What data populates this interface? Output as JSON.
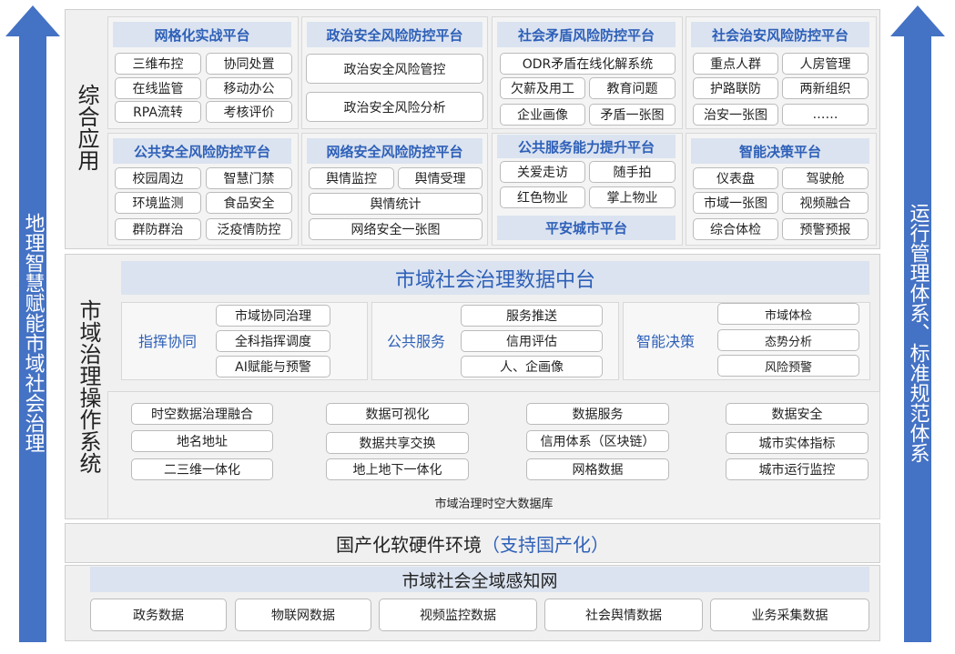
{
  "left_arrow": {
    "label": "地理智慧赋能市域社会治理"
  },
  "right_arrow": {
    "label": "运行管理体系、标准规范体系"
  },
  "app_layer": {
    "label": "综合应用",
    "platforms": [
      {
        "title": "网格化实战平台",
        "items": [
          "三维布控",
          "协同处置",
          "在线监管",
          "移动办公",
          "RPA流转",
          "考核评价"
        ]
      },
      {
        "title": "政治安全风险防控平台",
        "items": [
          "政治安全风险管控",
          "政治安全风险分析"
        ]
      },
      {
        "title": "社会矛盾风险防控平台",
        "items": [
          "ODR矛盾在线化解系统",
          "欠薪及用工",
          "教育问题",
          "企业画像",
          "矛盾一张图"
        ]
      },
      {
        "title": "社会治安风险防控平台",
        "items": [
          "重点人群",
          "人房管理",
          "护路联防",
          "两新组织",
          "治安一张图",
          "……"
        ]
      },
      {
        "title": "公共安全风险防控平台",
        "items": [
          "校园周边",
          "智慧门禁",
          "环境监测",
          "食品安全",
          "群防群治",
          "泛疫情防控"
        ]
      },
      {
        "title": "网络安全风险防控平台",
        "items": [
          "舆情监控",
          "舆情受理",
          "舆情统计",
          "网络安全一张图"
        ]
      },
      {
        "title": "公共服务能力提升平台",
        "items": [
          "关爱走访",
          "随手拍",
          "红色物业",
          "掌上物业"
        ],
        "footer": "平安城市平台"
      },
      {
        "title": "智能决策平台",
        "items": [
          "仪表盘",
          "驾驶舱",
          "市域一张图",
          "视频融合",
          "综合体检",
          "预警预报"
        ]
      }
    ]
  },
  "ops_layer": {
    "label": "市域治理操作系统",
    "hub_title": "市域社会治理数据中台",
    "groups": [
      {
        "label": "指挥协同",
        "items": [
          "市域协同治理",
          "全科指挥调度",
          "AI赋能与预警"
        ]
      },
      {
        "label": "公共服务",
        "items": [
          "服务推送",
          "信用评估",
          "人、企画像"
        ]
      },
      {
        "label": "智能决策",
        "items": [
          "市域体检",
          "态势分析",
          "风险预警"
        ]
      }
    ],
    "data_columns": [
      [
        "时空数据治理融合",
        "地名地址",
        "二三维一体化"
      ],
      [
        "数据可视化",
        "数据共享交换",
        "地上地下一体化"
      ],
      [
        "数据服务",
        "信用体系（区块链）",
        "网格数据"
      ],
      [
        "数据安全",
        "城市实体指标",
        "城市运行监控"
      ]
    ],
    "database_label": "市域治理时空大数据库"
  },
  "env_layer": {
    "label": "国产化软硬件环境",
    "highlight": "（支持国产化）"
  },
  "perception_layer": {
    "title": "市域社会全域感知网",
    "items": [
      "政务数据",
      "物联网数据",
      "视频监控数据",
      "社会舆情数据",
      "业务采集数据"
    ]
  },
  "colors": {
    "arrow": "#4472c4",
    "title_bg": "#dbe3f0",
    "title_text": "#2e60b8",
    "hub_text": "#2e60b8"
  }
}
